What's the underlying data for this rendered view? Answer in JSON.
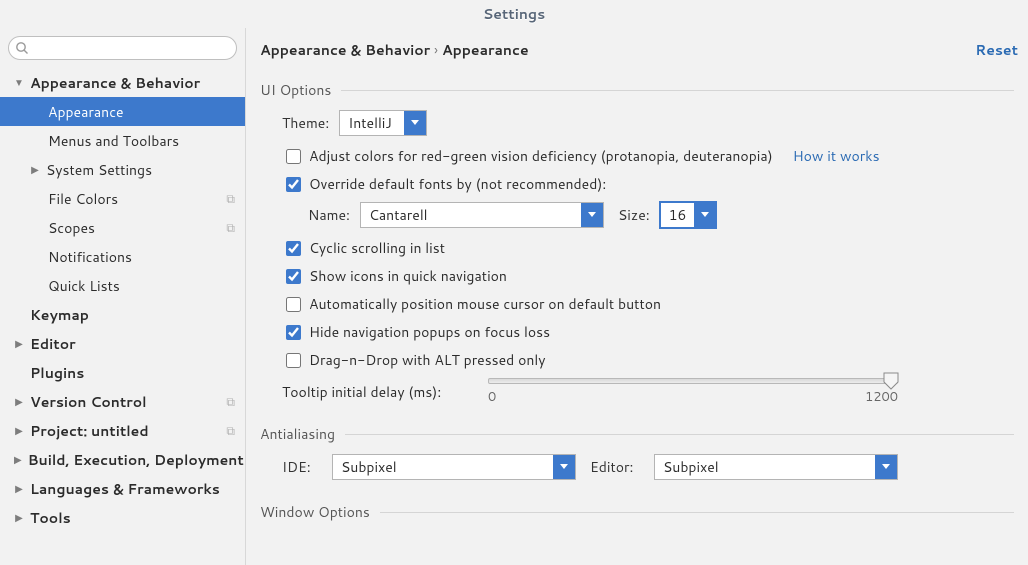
{
  "title": "Settings",
  "reset": "Reset",
  "crumbs": {
    "a": "Appearance & Behavior",
    "b": "Appearance"
  },
  "search": {
    "placeholder": ""
  },
  "sidebar": [
    {
      "l": 0,
      "arrow": "down",
      "label": "Appearance & Behavior"
    },
    {
      "l": 1,
      "label": "Appearance",
      "sel": true
    },
    {
      "l": 1,
      "label": "Menus and Toolbars"
    },
    {
      "l": 1,
      "arrow": "right",
      "label": "System Settings",
      "la": true
    },
    {
      "l": 1,
      "label": "File Colors",
      "proj": true
    },
    {
      "l": 1,
      "label": "Scopes",
      "proj": true
    },
    {
      "l": 1,
      "label": "Notifications"
    },
    {
      "l": 1,
      "label": "Quick Lists"
    },
    {
      "l": 0,
      "label": "Keymap"
    },
    {
      "l": 0,
      "arrow": "right",
      "label": "Editor"
    },
    {
      "l": 0,
      "label": "Plugins"
    },
    {
      "l": 0,
      "arrow": "right",
      "label": "Version Control",
      "proj": true
    },
    {
      "l": 0,
      "arrow": "right",
      "label": "Project: untitled",
      "proj": true
    },
    {
      "l": 0,
      "arrow": "right",
      "label": "Build, Execution, Deployment"
    },
    {
      "l": 0,
      "arrow": "right",
      "label": "Languages & Frameworks"
    },
    {
      "l": 0,
      "arrow": "right",
      "label": "Tools"
    }
  ],
  "ui": {
    "section": "UI Options",
    "theme_lbl": "Theme:",
    "theme_val": "IntelliJ",
    "adjust": "Adjust colors for red-green vision deficiency (protanopia, deuteranopia)",
    "how": "How it works",
    "override": "Override default fonts by (not recommended):",
    "name_lbl": "Name:",
    "name_val": "Cantarell",
    "size_lbl": "Size:",
    "size_val": "16",
    "cyclic": "Cyclic scrolling in list",
    "icons": "Show icons in quick navigation",
    "autopos": "Automatically position mouse cursor on default button",
    "hidepop": "Hide navigation popups on focus loss",
    "dnd": "Drag-n-Drop with ALT pressed only",
    "tooltip": "Tooltip initial delay (ms):",
    "min": "0",
    "max": "1200"
  },
  "aa": {
    "section": "Antialiasing",
    "ide_lbl": "IDE:",
    "ide_val": "Subpixel",
    "ed_lbl": "Editor:",
    "ed_val": "Subpixel"
  },
  "win": {
    "section": "Window Options"
  }
}
